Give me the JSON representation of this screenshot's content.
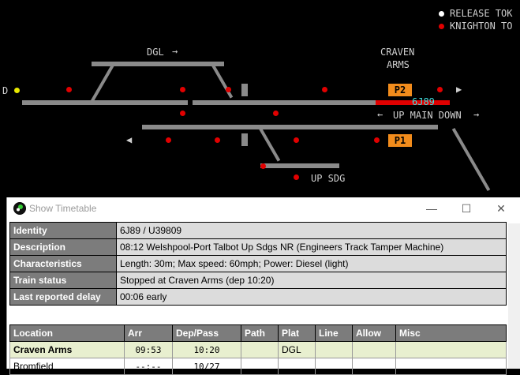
{
  "panel": {
    "release_text": "RELEASE TOK",
    "knighton_text": "KNIGHTON TO",
    "craven_line1": "CRAVEN",
    "craven_line2": "ARMS",
    "dgl_label": "DGL",
    "up_main_down": "UP MAIN DOWN",
    "up_sdg": "UP SDG",
    "p2": "P2",
    "p1": "P1",
    "headcode": "6J89",
    "left_d": "D",
    "colors": {
      "track": "#8a8a8a",
      "occupied": "#e10000",
      "platform": "#f28c1c",
      "signal_red": "#e10000",
      "signal_white": "#ffffff",
      "headcode": "#40e0e0"
    }
  },
  "window": {
    "title": "Show Timetable",
    "minimize": "—",
    "maximize": "☐",
    "close": "✕",
    "info": [
      {
        "label": "Identity",
        "value": "6J89 / U39809"
      },
      {
        "label": "Description",
        "value": "08:12 Welshpool-Port Talbot Up Sdgs NR (Engineers Track Tamper Machine)"
      },
      {
        "label": "Characteristics",
        "value": "Length: 30m; Max speed: 60mph; Power: Diesel (light)"
      },
      {
        "label": "Train status",
        "value": "Stopped at Craven Arms (dep 10:20)"
      },
      {
        "label": "Last reported delay",
        "value": "00:06 early"
      }
    ],
    "columns": [
      "Location",
      "Arr",
      "Dep/Pass",
      "Path",
      "Plat",
      "Line",
      "Allow",
      "Misc"
    ],
    "rows": [
      {
        "location": "Craven Arms",
        "arr": "09:53",
        "dep": "10:20",
        "path": "",
        "plat": "DGL",
        "line": "",
        "allow": "",
        "misc": ""
      },
      {
        "location": "Bromfield",
        "arr": "--:--",
        "dep": "10/27",
        "path": "",
        "plat": "",
        "line": "",
        "allow": "",
        "misc": ""
      }
    ]
  }
}
